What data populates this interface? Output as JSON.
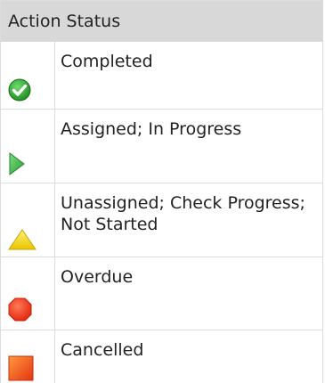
{
  "legend": {
    "title": "Action Status",
    "rows": [
      {
        "label": "Completed",
        "icon": "check-circle-icon",
        "color": "#2ea02e"
      },
      {
        "label": "Assigned; In Progress",
        "icon": "play-triangle-icon",
        "color": "#41b84a"
      },
      {
        "label": "Unassigned; Check Progress; Not Started",
        "icon": "warning-triangle-icon",
        "color": "#f2d21b"
      },
      {
        "label": "Overdue",
        "icon": "octagon-icon",
        "color": "#ee3b1c"
      },
      {
        "label": "Cancelled",
        "icon": "square-icon",
        "color": "#f05a28"
      }
    ]
  }
}
